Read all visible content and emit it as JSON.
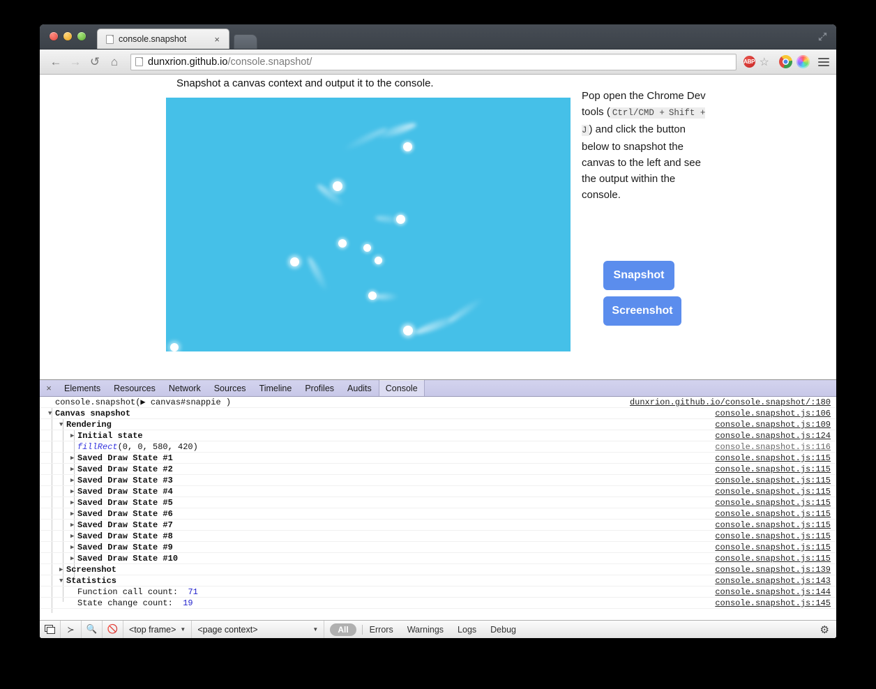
{
  "window": {
    "tab_title": "console.snapshot",
    "tab_close_label": "×",
    "url_host": "dunxrion.github.io",
    "url_path": "/console.snapshot/",
    "abp_label": "ABP"
  },
  "page": {
    "lede": "Snapshot a canvas context and output it to the console.",
    "sidecopy": {
      "part1": "Pop open the Chrome Dev tools (",
      "kbd1": "Ctrl/CMD +",
      "kbd2": "Shift + J",
      "part2": ") and click the button below to snapshot the canvas to the left and see the output within the console."
    },
    "buttons": {
      "snapshot": "Snapshot",
      "screenshot": "Screenshot"
    },
    "canvas_color": "#45c0e8"
  },
  "devtools": {
    "close_label": "×",
    "tabs": [
      {
        "label": "Elements",
        "active": false
      },
      {
        "label": "Resources",
        "active": false
      },
      {
        "label": "Network",
        "active": false
      },
      {
        "label": "Sources",
        "active": false
      },
      {
        "label": "Timeline",
        "active": false
      },
      {
        "label": "Profiles",
        "active": false
      },
      {
        "label": "Audits",
        "active": false
      },
      {
        "label": "Console",
        "active": true
      }
    ],
    "console_rows": [
      {
        "indent": 0,
        "disc": "",
        "text": "console.snapshot(▶ canvas#snappie )",
        "link": "dunxrion.github.io/console.snapshot/:180",
        "faint": false
      },
      {
        "indent": 0,
        "disc": "▼",
        "text": "Canvas snapshot",
        "link": "console.snapshot.js:106",
        "faint": false
      },
      {
        "indent": 1,
        "disc": "▼",
        "text": "Rendering",
        "link": "console.snapshot.js:109",
        "faint": false
      },
      {
        "indent": 2,
        "disc": "▶",
        "text": "Initial state",
        "link": "console.snapshot.js:124",
        "faint": false
      },
      {
        "indent": 2,
        "disc": "",
        "text": "fillRect(0, 0, 580, 420)",
        "link": "console.snapshot.js:116",
        "faint": true,
        "code": true
      },
      {
        "indent": 2,
        "disc": "▶",
        "text": "Saved Draw State #1",
        "link": "console.snapshot.js:115",
        "faint": false
      },
      {
        "indent": 2,
        "disc": "▶",
        "text": "Saved Draw State #2",
        "link": "console.snapshot.js:115",
        "faint": false
      },
      {
        "indent": 2,
        "disc": "▶",
        "text": "Saved Draw State #3",
        "link": "console.snapshot.js:115",
        "faint": false
      },
      {
        "indent": 2,
        "disc": "▶",
        "text": "Saved Draw State #4",
        "link": "console.snapshot.js:115",
        "faint": false
      },
      {
        "indent": 2,
        "disc": "▶",
        "text": "Saved Draw State #5",
        "link": "console.snapshot.js:115",
        "faint": false
      },
      {
        "indent": 2,
        "disc": "▶",
        "text": "Saved Draw State #6",
        "link": "console.snapshot.js:115",
        "faint": false
      },
      {
        "indent": 2,
        "disc": "▶",
        "text": "Saved Draw State #7",
        "link": "console.snapshot.js:115",
        "faint": false
      },
      {
        "indent": 2,
        "disc": "▶",
        "text": "Saved Draw State #8",
        "link": "console.snapshot.js:115",
        "faint": false
      },
      {
        "indent": 2,
        "disc": "▶",
        "text": "Saved Draw State #9",
        "link": "console.snapshot.js:115",
        "faint": false
      },
      {
        "indent": 2,
        "disc": "▶",
        "text": "Saved Draw State #10",
        "link": "console.snapshot.js:115",
        "faint": false
      },
      {
        "indent": 1,
        "disc": "▶",
        "text": "Screenshot",
        "link": "console.snapshot.js:139",
        "faint": false
      },
      {
        "indent": 1,
        "disc": "▼",
        "text": "Statistics",
        "link": "console.snapshot.js:143",
        "faint": false
      },
      {
        "indent": 2,
        "disc": "",
        "text": "Function call count:  71",
        "link": "console.snapshot.js:144",
        "faint": false,
        "stat": true
      },
      {
        "indent": 2,
        "disc": "",
        "text": "State change count:  19",
        "link": "console.snapshot.js:145",
        "faint": false,
        "stat": true
      }
    ],
    "status": {
      "frame_select": "<top frame>",
      "context_select": "<page context>",
      "all_pill": "All",
      "filters": [
        "Errors",
        "Warnings",
        "Logs",
        "Debug"
      ]
    }
  }
}
